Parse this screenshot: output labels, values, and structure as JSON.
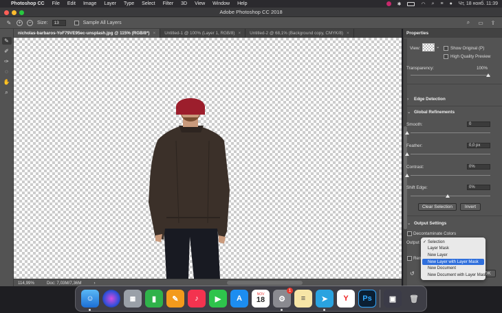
{
  "menubar": {
    "app": "Photoshop CC",
    "items": [
      "File",
      "Edit",
      "Image",
      "Layer",
      "Type",
      "Select",
      "Filter",
      "3D",
      "View",
      "Window",
      "Help"
    ],
    "clock": "Чт, 18 нояб.  11:39"
  },
  "window": {
    "title": "Adobe Photoshop CC 2018"
  },
  "options": {
    "size_label": "Size:",
    "size_value": "13",
    "sample_all_layers": "Sample All Layers"
  },
  "tabs": [
    {
      "label": "nicholas-barbaros-YoF79VE95ec-unsplash.jpg @ 115% (RGB/8*)",
      "close": "×"
    },
    {
      "label": "Untitled-1 @ 100% (Layer 1, RGB/8)",
      "close": "×"
    },
    {
      "label": "Untitled-2 @ 68,1% (Background copy, CMYK/8)",
      "close": "×"
    }
  ],
  "status": {
    "zoom": "114,99%",
    "doc": "Doc: 7,03M/7,36M",
    "arrow": "›"
  },
  "properties": {
    "tab": "Properties",
    "view_label": "View:",
    "show_original": "Show Original (P)",
    "high_quality": "High Quality Preview",
    "transparency_label": "Transparency:",
    "transparency_value": "100%",
    "transparency_level": 1.0,
    "edge_detection": "Edge Detection",
    "global_refinements": "Global Refinements",
    "smooth_label": "Smooth:",
    "smooth_value": "0",
    "smooth_level": 0.0,
    "feather_label": "Feather:",
    "feather_value": "0,0 px",
    "feather_level": 0.0,
    "contrast_label": "Contrast:",
    "contrast_value": "0%",
    "contrast_level": 0.0,
    "shift_label": "Shift Edge:",
    "shift_value": "0%",
    "shift_level": 0.5,
    "clear_selection": "Clear Selection",
    "invert": "Invert",
    "output_settings": "Output Settings",
    "decontaminate": "Decontaminate Colors",
    "output_to_label": "Output To",
    "remember": "Remem",
    "ok": "OK"
  },
  "output_dropdown": {
    "items": [
      "Selection",
      "Layer Mask",
      "New Layer",
      "New Layer with Layer Mask",
      "New Document",
      "New Document with Layer Mask"
    ],
    "checked": "Selection",
    "highlighted": "New Layer with Layer Mask"
  },
  "dock": {
    "calendar_month": "NOV",
    "calendar_day": "18",
    "settings_badge": "1",
    "ps_label": "Ps"
  },
  "colors": {
    "accent": "#2f6fdc",
    "panel": "#535353",
    "canvas_check": "#cccccc"
  }
}
